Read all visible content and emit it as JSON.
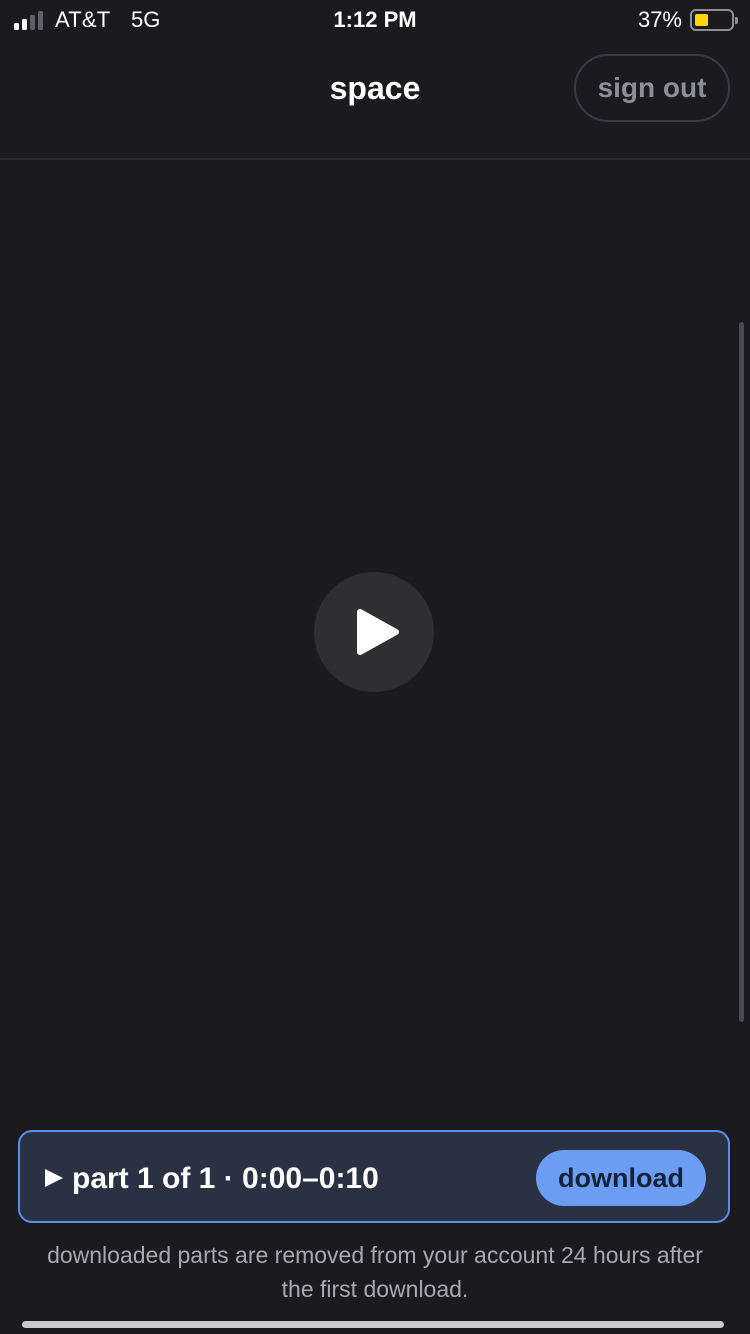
{
  "status_bar": {
    "carrier": "AT&T",
    "network": "5G",
    "time": "1:12 PM",
    "battery_percent": "37%",
    "battery_level": 0.37,
    "battery_color": "#ffd60a"
  },
  "header": {
    "title": "space",
    "sign_out_label": "sign out"
  },
  "player": {
    "play_icon": "play-icon"
  },
  "part": {
    "label": "part 1 of 1 · 0:00–0:10",
    "download_label": "download",
    "accent_color": "#6b9ef2"
  },
  "notice": {
    "text": "downloaded parts are removed from your account 24 hours after the first download."
  }
}
